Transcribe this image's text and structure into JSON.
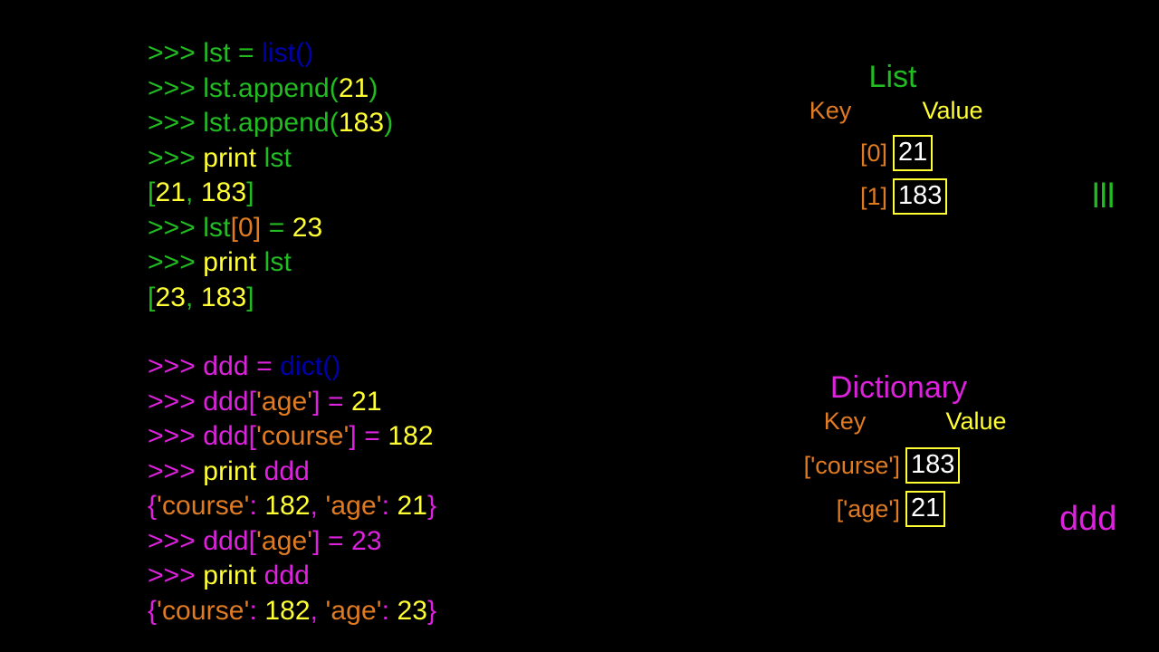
{
  "colors": {
    "background": "#000000",
    "green": "#22bb22",
    "magenta": "#dd22dd",
    "yellow": "#ffff33",
    "blue": "#0000aa",
    "orange": "#e07b22",
    "white": "#ffffff"
  },
  "list_code": {
    "line1": {
      "prompt": ">>> ",
      "var": "lst",
      "op": " = ",
      "call": "list()"
    },
    "line2": {
      "prompt": ">>> ",
      "var": "lst.append(",
      "arg": "21",
      "close": ")"
    },
    "line3": {
      "prompt": ">>> ",
      "var": "lst.append(",
      "arg": "183",
      "close": ")"
    },
    "line4": {
      "prompt": ">>> ",
      "kw": "print ",
      "var": "lst"
    },
    "line5": {
      "open": "[",
      "a": "21",
      "comma": ", ",
      "b": "183",
      "close": "]"
    },
    "line6": {
      "prompt": ">>> ",
      "var": "lst",
      "idx": "[0]",
      "op": " = ",
      "num": "23"
    },
    "line7": {
      "prompt": ">>> ",
      "kw": "print ",
      "var": "lst"
    },
    "line8": {
      "open": "[",
      "a": "23",
      "comma": ", ",
      "b": "183",
      "close": "]"
    }
  },
  "dict_code": {
    "line1": {
      "prompt": ">>> ",
      "var": "ddd",
      "op": " = ",
      "call": "dict()"
    },
    "line2": {
      "prompt": ">>> ",
      "var": "ddd[",
      "key": "'age'",
      "bracket": "]",
      "op": " = ",
      "num": "21"
    },
    "line3": {
      "prompt": ">>> ",
      "var": "ddd[",
      "key": "'course'",
      "bracket": "]",
      "op": " = ",
      "num": "182"
    },
    "line4": {
      "prompt": ">>> ",
      "kw": "print ",
      "var": "ddd"
    },
    "line5": {
      "open": "{",
      "k1": "'course'",
      "colon1": ": ",
      "v1": "182",
      "comma": ", ",
      "k2": "'age'",
      "colon2": ": ",
      "v2": "21",
      "close": "}"
    },
    "line6": {
      "prompt": ">>> ",
      "var": "ddd[",
      "key": "'age'",
      "bracket": "]",
      "op": " = ",
      "num": "23"
    },
    "line7": {
      "prompt": ">>> ",
      "kw": "print ",
      "var": "ddd"
    },
    "line8": {
      "open": "{",
      "k1": "'course'",
      "colon1": ": ",
      "v1": "182",
      "comma": ", ",
      "k2": "'age'",
      "colon2": ": ",
      "v2": "23",
      "close": "}"
    }
  },
  "list_diagram": {
    "title": "List",
    "key_header": "Key",
    "value_header": "Value",
    "rows": [
      {
        "key": "[0]",
        "value": "21"
      },
      {
        "key": "[1]",
        "value": "183"
      }
    ]
  },
  "dict_diagram": {
    "title": "Dictionary",
    "key_header": "Key",
    "value_header": "Value",
    "rows": [
      {
        "key": "['course']",
        "value": "183"
      },
      {
        "key": "['age']",
        "value": "21"
      }
    ]
  },
  "var_tags": {
    "list_tag": "lll",
    "dict_tag": "ddd"
  }
}
